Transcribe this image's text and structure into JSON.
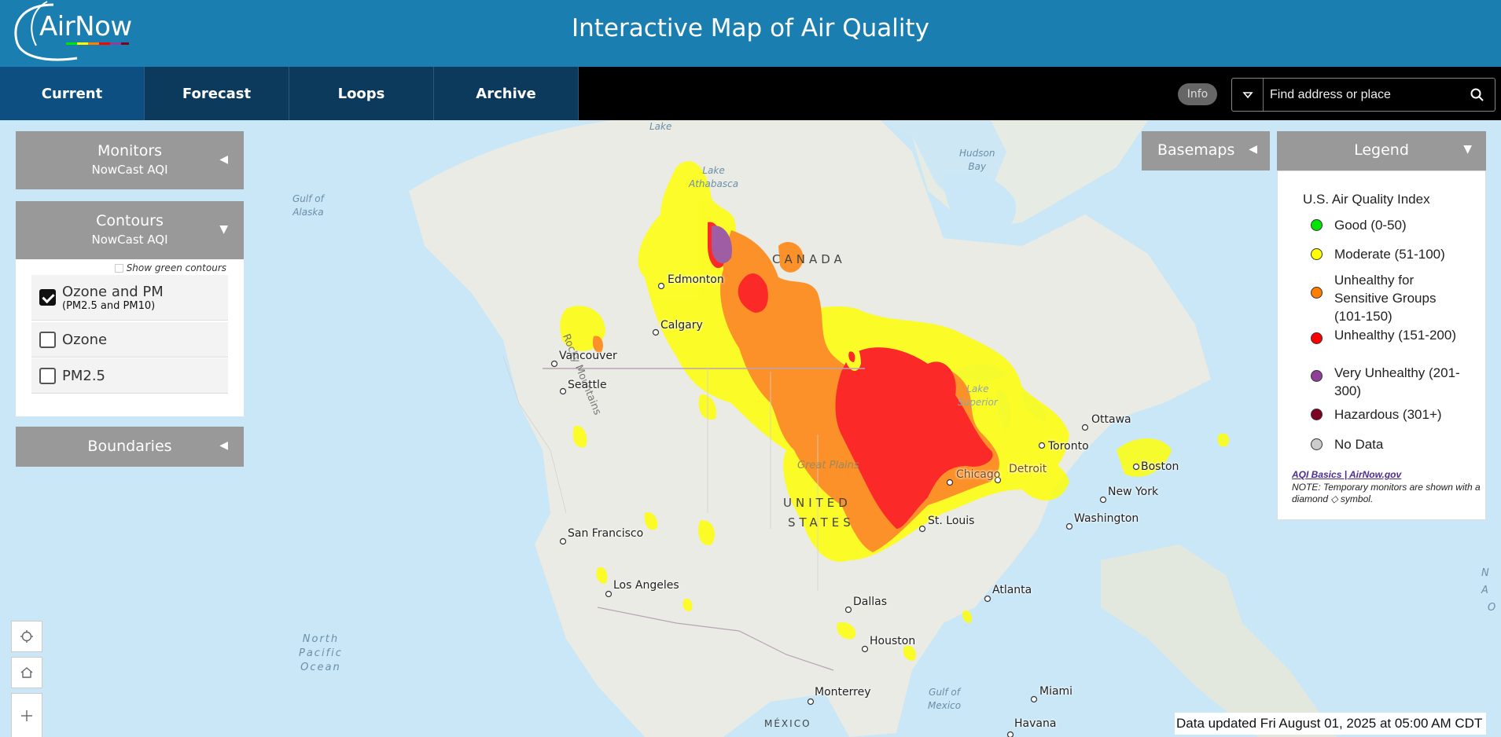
{
  "header": {
    "logo_text": "AirNow",
    "title": "Interactive Map of Air Quality"
  },
  "nav": {
    "tabs": [
      {
        "label": "Current"
      },
      {
        "label": "Forecast"
      },
      {
        "label": "Loops"
      },
      {
        "label": "Archive"
      }
    ],
    "info_label": "Info",
    "search_placeholder": "Find address or place"
  },
  "panels": {
    "monitors": {
      "title": "Monitors",
      "subtitle": "NowCast AQI"
    },
    "contours": {
      "title": "Contours",
      "subtitle": "NowCast AQI",
      "show_green_label": "Show green contours",
      "options": [
        {
          "label": "Ozone and PM",
          "sublabel": "(PM2.5 and PM10)",
          "checked": true
        },
        {
          "label": "Ozone",
          "sublabel": "",
          "checked": false
        },
        {
          "label": "PM2.5",
          "sublabel": "",
          "checked": false
        }
      ]
    },
    "boundaries": {
      "title": "Boundaries"
    },
    "basemaps": {
      "title": "Basemaps"
    }
  },
  "legend": {
    "header": "Legend",
    "title": "U.S. Air Quality Index",
    "items": [
      {
        "label": "Good (0-50)",
        "color": "#00e400"
      },
      {
        "label": "Moderate (51-100)",
        "color": "#ffff00"
      },
      {
        "label": "Unhealthy for Sensitive Groups (101-150)",
        "color": "#ff7e00"
      },
      {
        "label": "Unhealthy (151-200)",
        "color": "#ff0000"
      },
      {
        "label": "Very Unhealthy (201-300)",
        "color": "#8f3f97"
      },
      {
        "label": "Hazardous (301+)",
        "color": "#7e0023"
      },
      {
        "label": "No Data",
        "color": "#cccccc"
      }
    ],
    "link": "AQI Basics | AirNow.gov",
    "note": "NOTE: Temporary monitors are shown with a diamond ◇ symbol."
  },
  "map": {
    "water_labels": [
      {
        "text": "Lake"
      },
      {
        "text": "Lake\nAthabasca"
      },
      {
        "text": "Hudson\nBay"
      },
      {
        "text": "Gulf of\nAlaska"
      },
      {
        "text": "North\nPacific\nOcean"
      },
      {
        "text": "Lake\nSuperior"
      },
      {
        "text": "Gulf of\nMexico"
      }
    ],
    "region_labels": [
      {
        "text": "CANADA"
      },
      {
        "text": "UNITED"
      },
      {
        "text": "STATES"
      },
      {
        "text": "Rocky Mountains"
      },
      {
        "text": "Great Plains"
      },
      {
        "text": "MÉXICO"
      }
    ],
    "cities": [
      {
        "name": "Edmonton"
      },
      {
        "name": "Calgary"
      },
      {
        "name": "Vancouver"
      },
      {
        "name": "Seattle"
      },
      {
        "name": "San Francisco"
      },
      {
        "name": "Los Angeles"
      },
      {
        "name": "Dallas"
      },
      {
        "name": "Houston"
      },
      {
        "name": "Monterrey"
      },
      {
        "name": "St. Louis"
      },
      {
        "name": "Chicago"
      },
      {
        "name": "Detroit"
      },
      {
        "name": "Toronto"
      },
      {
        "name": "Ottawa"
      },
      {
        "name": "Boston"
      },
      {
        "name": "New York"
      },
      {
        "name": "Washington"
      },
      {
        "name": "Atlanta"
      },
      {
        "name": "Miami"
      },
      {
        "name": "Havana"
      }
    ],
    "edge_fragments": [
      "N",
      "A",
      "O"
    ]
  },
  "status": {
    "data_updated": "Data updated Fri August 01, 2025 at 05:00 AM CDT"
  }
}
